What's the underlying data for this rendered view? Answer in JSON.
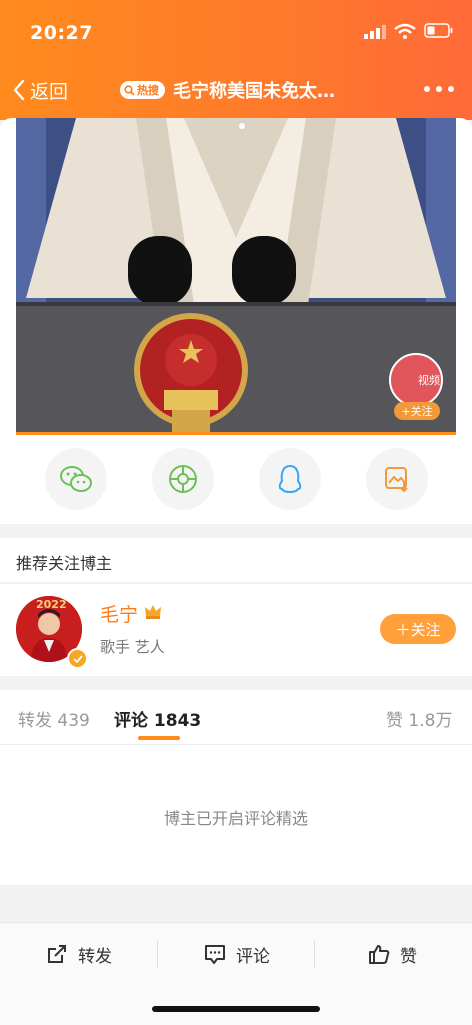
{
  "status_bar": {
    "time": "20:27"
  },
  "nav": {
    "back_label": "返回",
    "hot_badge": "热搜",
    "title": "毛宁称美国未免太…"
  },
  "video": {
    "watermark_label": "视频",
    "follow_label": "+关注"
  },
  "share": {
    "icons": [
      "wechat-icon",
      "moments-icon",
      "qq-icon",
      "save-image-icon"
    ]
  },
  "recommend": {
    "title": "推荐关注博主",
    "user": {
      "name": "毛宁",
      "tags": "歌手 艺人",
      "avatar_caption": "2022",
      "follow_label": "＋关注"
    }
  },
  "tabs": {
    "repost": "转发 439",
    "comment": "评论 1843",
    "like": "赞 1.8万"
  },
  "comments": {
    "placeholder": "博主已开启评论精选"
  },
  "bottom_bar": {
    "repost": "转发",
    "comment": "评论",
    "like": "赞"
  },
  "colors": {
    "accent": "#ff8a1d",
    "follow_button": "#ffa03a",
    "username": "#ff7a18"
  }
}
